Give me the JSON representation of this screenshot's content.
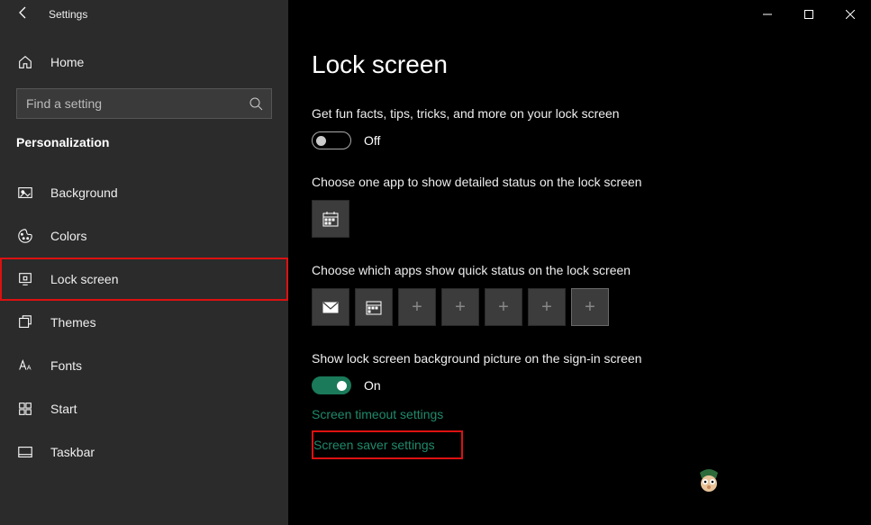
{
  "app": {
    "title": "Settings"
  },
  "home": {
    "label": "Home"
  },
  "search": {
    "placeholder": "Find a setting"
  },
  "section": {
    "title": "Personalization"
  },
  "nav": {
    "items": [
      {
        "label": "Background"
      },
      {
        "label": "Colors"
      },
      {
        "label": "Lock screen"
      },
      {
        "label": "Themes"
      },
      {
        "label": "Fonts"
      },
      {
        "label": "Start"
      },
      {
        "label": "Taskbar"
      }
    ],
    "selected_index": 2
  },
  "page": {
    "title": "Lock screen",
    "funfacts": {
      "label": "Get fun facts, tips, tricks, and more on your lock screen",
      "state": "Off",
      "on": false
    },
    "detailed": {
      "label": "Choose one app to show detailed status on the lock screen",
      "app": "Calendar"
    },
    "quick": {
      "label": "Choose which apps show quick status on the lock screen",
      "slots": [
        "Mail",
        "Calendar",
        "Add",
        "Add",
        "Add",
        "Add",
        "Add"
      ]
    },
    "signin": {
      "label": "Show lock screen background picture on the sign-in screen",
      "state": "On",
      "on": true
    },
    "links": {
      "timeout": "Screen timeout settings",
      "saver": "Screen saver settings"
    }
  }
}
